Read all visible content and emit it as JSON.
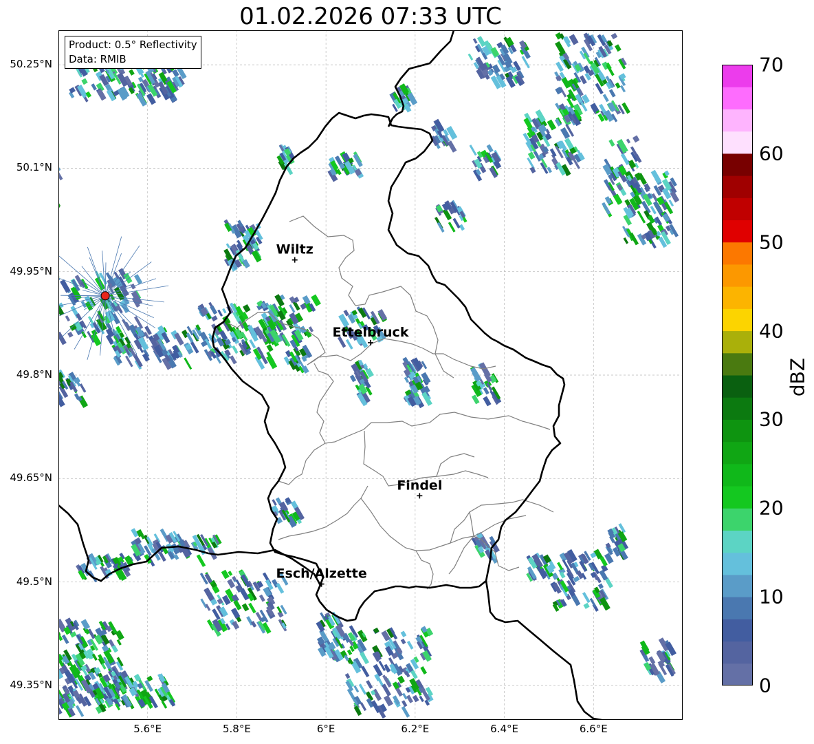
{
  "title": "01.02.2026 07:33 UTC",
  "info": {
    "product": "Product: 0.5° Reflectivity",
    "data": "Data: RMIB"
  },
  "axes": {
    "lon_range": [
      5.4,
      6.8
    ],
    "lat_range": [
      49.3,
      50.3
    ],
    "x_ticks": [
      {
        "value": 5.6,
        "label": "5.6°E"
      },
      {
        "value": 5.8,
        "label": "5.8°E"
      },
      {
        "value": 6.0,
        "label": "6°E"
      },
      {
        "value": 6.2,
        "label": "6.2°E"
      },
      {
        "value": 6.4,
        "label": "6.4°E"
      },
      {
        "value": 6.6,
        "label": "6.6°E"
      }
    ],
    "y_ticks": [
      {
        "value": 50.25,
        "label": "50.25°N"
      },
      {
        "value": 50.1,
        "label": "50.1°N"
      },
      {
        "value": 49.95,
        "label": "49.95°N"
      },
      {
        "value": 49.8,
        "label": "49.8°N"
      },
      {
        "value": 49.65,
        "label": "49.65°N"
      },
      {
        "value": 49.5,
        "label": "49.5°N"
      },
      {
        "value": 49.35,
        "label": "49.35°N"
      }
    ],
    "grid": true
  },
  "cities": [
    {
      "name": "Wiltz",
      "lon": 5.93,
      "lat": 49.967
    },
    {
      "name": "Ettelbruck",
      "lon": 6.1,
      "lat": 49.847
    },
    {
      "name": "Findel",
      "lon": 6.21,
      "lat": 49.625
    },
    {
      "name": "Esch/Alzette",
      "lon": 5.99,
      "lat": 49.497
    }
  ],
  "radar_site": {
    "lon": 5.505,
    "lat": 49.915,
    "color": "#e8261c"
  },
  "colorbar": {
    "label": "dBZ",
    "min": 0,
    "max": 70,
    "ticks": [
      0,
      10,
      20,
      30,
      40,
      50,
      60,
      70
    ],
    "colors": [
      "#6470a6",
      "#5464a0",
      "#425da0",
      "#4a78b0",
      "#5a9cc8",
      "#64c0dc",
      "#5cd4c4",
      "#3cd46c",
      "#14c820",
      "#10b81a",
      "#10a614",
      "#0e9410",
      "#0c7a10",
      "#0a6010",
      "#4a7a10",
      "#aab00a",
      "#fcd400",
      "#fcb400",
      "#fc9800",
      "#fc7800",
      "#e00000",
      "#c00000",
      "#a00000",
      "#780000",
      "#fee0fe",
      "#feb4fe",
      "#fe6cfe",
      "#ec3cec"
    ]
  },
  "colors": {
    "border": "#000000",
    "cantons": "#808080",
    "grid": "#b8b8b8"
  }
}
